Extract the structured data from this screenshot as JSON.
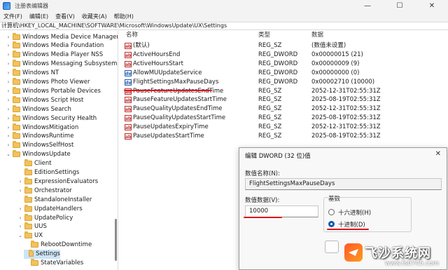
{
  "window": {
    "title": "注册表编辑器",
    "minimize": "—",
    "maximize": "☐",
    "close": "✕"
  },
  "menu": [
    "文件(F)",
    "编辑(E)",
    "查看(V)",
    "收藏夹(A)",
    "帮助(H)"
  ],
  "address": "计算机\\HKEY_LOCAL_MACHINE\\SOFTWARE\\Microsoft\\WindowsUpdate\\UX\\Settings",
  "tree": {
    "items": [
      {
        "label": "Windows Media Device Manager",
        "expander": ">",
        "level": 1
      },
      {
        "label": "Windows Media Foundation",
        "expander": ">",
        "level": 1
      },
      {
        "label": "Windows Media Player NSS",
        "expander": ">",
        "level": 1
      },
      {
        "label": "Windows Messaging Subsystem",
        "expander": ">",
        "level": 1
      },
      {
        "label": "Windows NT",
        "expander": ">",
        "level": 1
      },
      {
        "label": "Windows Photo Viewer",
        "expander": ">",
        "level": 1
      },
      {
        "label": "Windows Portable Devices",
        "expander": ">",
        "level": 1
      },
      {
        "label": "Windows Script Host",
        "expander": ">",
        "level": 1
      },
      {
        "label": "Windows Search",
        "expander": ">",
        "level": 1
      },
      {
        "label": "Windows Security Health",
        "expander": ">",
        "level": 1
      },
      {
        "label": "WindowsMitigation",
        "expander": ">",
        "level": 1
      },
      {
        "label": "WindowsRuntime",
        "expander": ">",
        "level": 1
      },
      {
        "label": "WindowsSelfHost",
        "expander": ">",
        "level": 1
      },
      {
        "label": "WindowsUpdate",
        "expander": "v",
        "level": 1
      },
      {
        "label": "Client",
        "expander": "",
        "level": 2
      },
      {
        "label": "EditionSettings",
        "expander": "",
        "level": 2
      },
      {
        "label": "ExpressionEvaluators",
        "expander": ">",
        "level": 2
      },
      {
        "label": "Orchestrator",
        "expander": ">",
        "level": 2
      },
      {
        "label": "StandaloneInstaller",
        "expander": "",
        "level": 2
      },
      {
        "label": "UpdateHandlers",
        "expander": ">",
        "level": 2
      },
      {
        "label": "UpdatePolicy",
        "expander": ">",
        "level": 2
      },
      {
        "label": "UUS",
        "expander": ">",
        "level": 2
      },
      {
        "label": "UX",
        "expander": "v",
        "level": 2
      },
      {
        "label": "RebootDowntime",
        "expander": "",
        "level": 3
      },
      {
        "label": "Settings",
        "expander": "",
        "level": 3,
        "selected": true
      },
      {
        "label": "StateVariables",
        "expander": "",
        "level": 3
      }
    ]
  },
  "columns": {
    "name": "名称",
    "type": "类型",
    "data": "数据"
  },
  "values": [
    {
      "icon": "ab",
      "name": "(默认)",
      "type": "REG_SZ",
      "data": "(数值未设置)"
    },
    {
      "icon": "ab",
      "name": "ActiveHoursEnd",
      "type": "REG_DWORD",
      "data": "0x00000015 (21)"
    },
    {
      "icon": "ab",
      "name": "ActiveHoursStart",
      "type": "REG_DWORD",
      "data": "0x00000009 (9)"
    },
    {
      "icon": "dw",
      "name": "AllowMUUpdateService",
      "type": "REG_DWORD",
      "data": "0x00000000 (0)"
    },
    {
      "icon": "dw",
      "name": "FlightSettingsMaxPauseDays",
      "type": "REG_DWORD",
      "data": "0x00002710 (10000)"
    },
    {
      "icon": "ab",
      "name": "PauseFeatureUpdatesEndTime",
      "type": "REG_SZ",
      "data": "2052-12-31T02:55:31Z"
    },
    {
      "icon": "ab",
      "name": "PauseFeatureUpdatesStartTime",
      "type": "REG_SZ",
      "data": "2025-08-19T02:55:31Z"
    },
    {
      "icon": "ab",
      "name": "PauseQualityUpdatesEndTime",
      "type": "REG_SZ",
      "data": "2052-12-31T02:55:31Z"
    },
    {
      "icon": "ab",
      "name": "PauseQualityUpdatesStartTime",
      "type": "REG_SZ",
      "data": "2025-08-19T02:55:31Z"
    },
    {
      "icon": "ab",
      "name": "PauseUpdatesExpiryTime",
      "type": "REG_SZ",
      "data": "2052-12-31T02:55:31Z"
    },
    {
      "icon": "ab",
      "name": "PauseUpdatesStartTime",
      "type": "REG_SZ",
      "data": "2025-08-19T02:55:31Z"
    }
  ],
  "dialog": {
    "title": "编辑 DWORD (32 位)值",
    "close": "✕",
    "name_label": "数值名称(N):",
    "name_value": "FlightSettingsMaxPauseDays",
    "data_label": "数值数据(V):",
    "data_value": "10000",
    "base_label": "基数",
    "hex_label": "十六进制(H)",
    "dec_label": "十进制(D)",
    "selected_base": "十进制(D)"
  },
  "watermark": {
    "name": "飞沙系统网",
    "url": "www.fs0745.com"
  },
  "annotation_color": "#e0141b"
}
